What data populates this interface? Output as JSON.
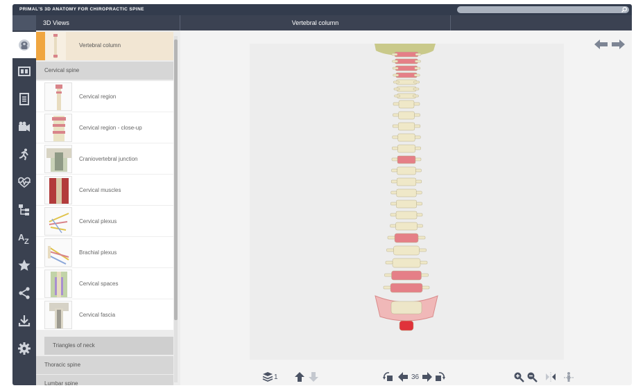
{
  "app": {
    "title": "PRIMAL'S 3D ANATOMY FOR CHIROPRACTIC SPINE"
  },
  "search": {
    "placeholder": ""
  },
  "header": {
    "panel_title": "3D Views",
    "view_title": "Vertebral column"
  },
  "rail": {
    "icons": [
      "head-3d-icon",
      "slides-icon",
      "text-book-icon",
      "video-icon",
      "animation-icon",
      "pulse-icon",
      "hierarchy-icon",
      "a-z-index-icon",
      "favorite-star-icon",
      "share-icon",
      "download-icon",
      "settings-gear-icon"
    ],
    "active": "head-3d-icon"
  },
  "panel": {
    "selected": {
      "label": "Vertebral column"
    },
    "section_cervical": "Cervical spine",
    "items": [
      {
        "label": "Cervical region"
      },
      {
        "label": "Cervical region - close-up"
      },
      {
        "label": "Craniovertebral junction"
      },
      {
        "label": "Cervical muscles"
      },
      {
        "label": "Cervical plexus"
      },
      {
        "label": "Brachial plexus"
      },
      {
        "label": "Cervical spaces"
      },
      {
        "label": "Cervical fascia"
      }
    ],
    "subsection": "Triangles of neck",
    "section_thoracic": "Thoracic spine",
    "section_lumbar": "Lumbar spine"
  },
  "toolbar": {
    "layer_count": "1",
    "slice_number": "36"
  },
  "colors": {
    "titlebar": "#333c4d",
    "header": "#3b4252",
    "rail": "#3a4150",
    "accent": "#f0a640",
    "selected_row": "#f2e6d3",
    "bone": "#efe8c8",
    "disc": "#e57f87",
    "icon": "#4a5263"
  }
}
